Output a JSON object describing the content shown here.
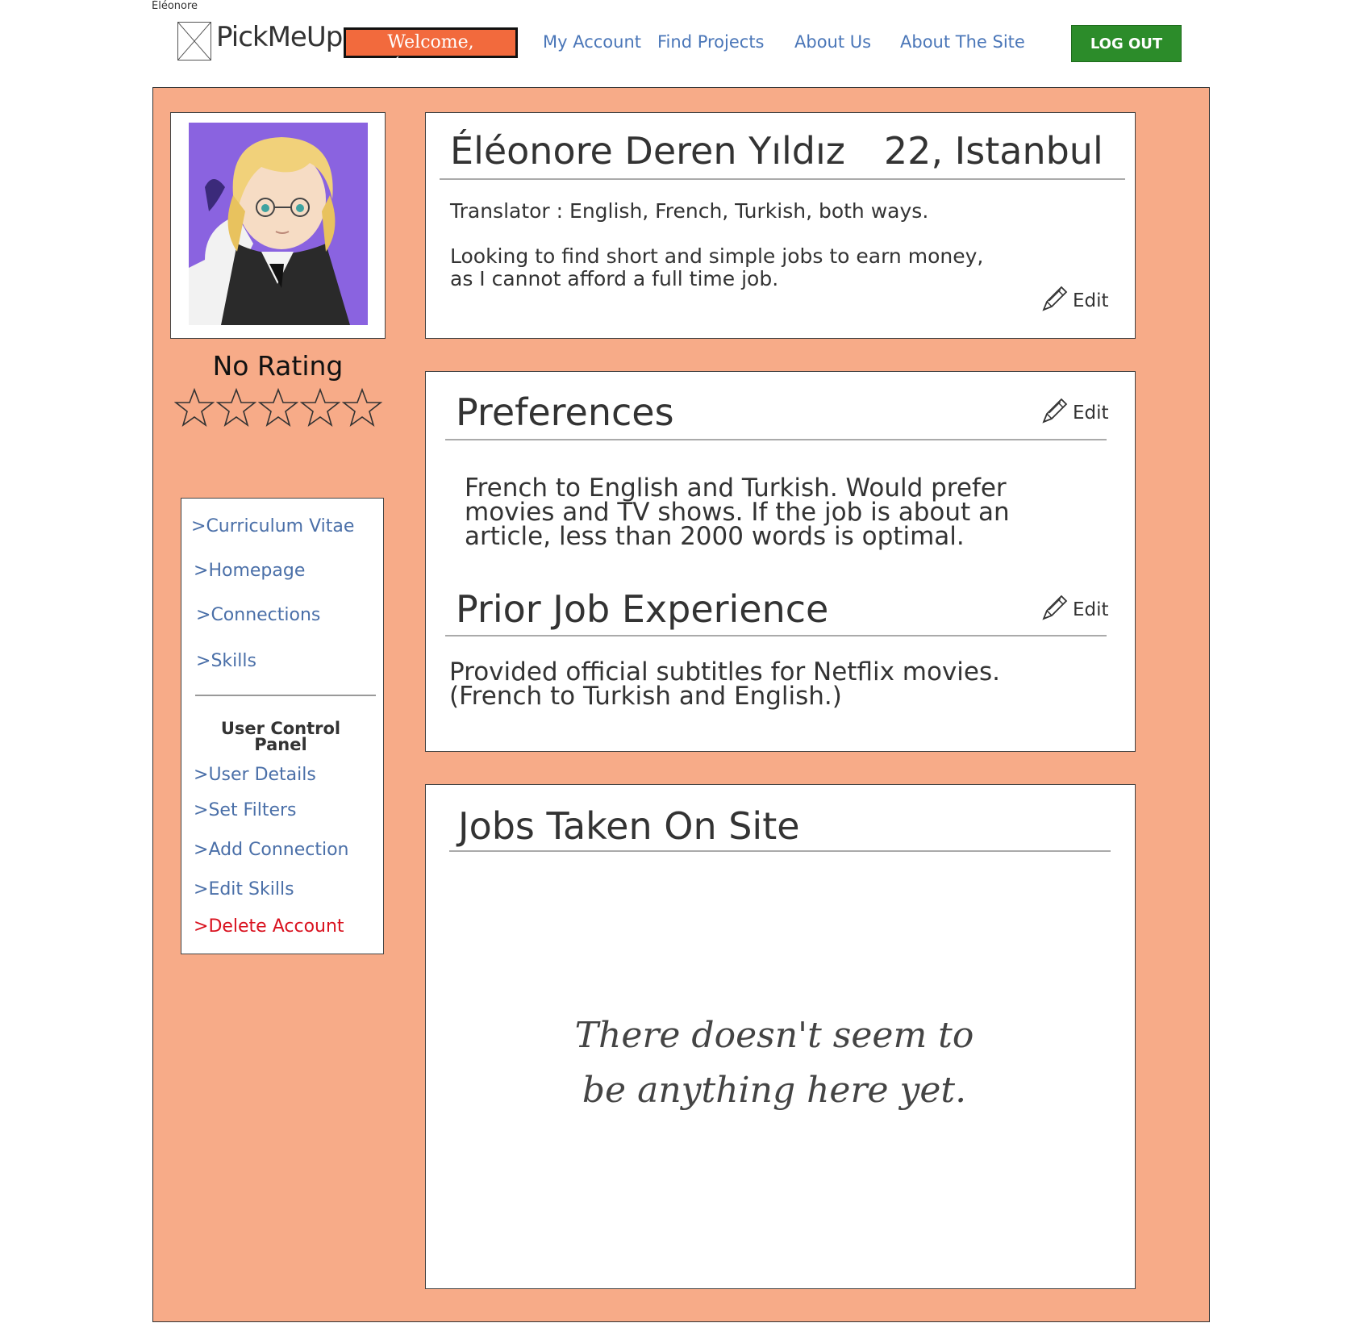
{
  "header": {
    "corner_user": "Éléonore",
    "logo_text": "PickMeUp",
    "welcome": "Welcome, Éléonore",
    "nav": [
      "My Account",
      "Find Projects",
      "About Us",
      "About The Site"
    ],
    "logout": "LOG OUT"
  },
  "profile": {
    "name": "Éléonore Deren Yıldız",
    "age_city": "22, Istanbul",
    "role": "Translator : English, French, Turkish, both ways.",
    "bio_line1": "Looking to find short and simple jobs to earn money,",
    "bio_line2": "as I cannot afford a full time job.",
    "edit_label": "Edit"
  },
  "rating": {
    "label": "No Rating",
    "value": 0,
    "max": 5
  },
  "sidebar": {
    "links": [
      "Curriculum Vitae",
      "Homepage",
      "Connections",
      "Skills"
    ],
    "prefix": ">",
    "control_panel_title_1": "User Control",
    "control_panel_title_2": "Panel",
    "control_links": [
      "User Details",
      "Set Filters",
      "Add Connection",
      "Edit Skills"
    ],
    "delete_link": "Delete Account"
  },
  "preferences": {
    "title": "Preferences",
    "line1": "French to English and Turkish. Would prefer",
    "line2": "movies and TV shows. If the job is about an",
    "line3": "article, less than 2000 words is optimal.",
    "edit_label": "Edit"
  },
  "experience": {
    "title": "Prior Job Experience",
    "line1": "Provided official subtitles for Netflix movies.",
    "line2": "(French to Turkish and English.)",
    "edit_label": "Edit"
  },
  "jobs": {
    "title": "Jobs Taken On Site",
    "empty_line1": "There doesn't seem to",
    "empty_line2": "be anything here yet."
  },
  "colors": {
    "panel_bg": "#f7ab88",
    "welcome_bg": "#f26a3d",
    "logout_bg": "#2c8c2a",
    "link": "#4a76b8",
    "danger": "#d9121f"
  }
}
